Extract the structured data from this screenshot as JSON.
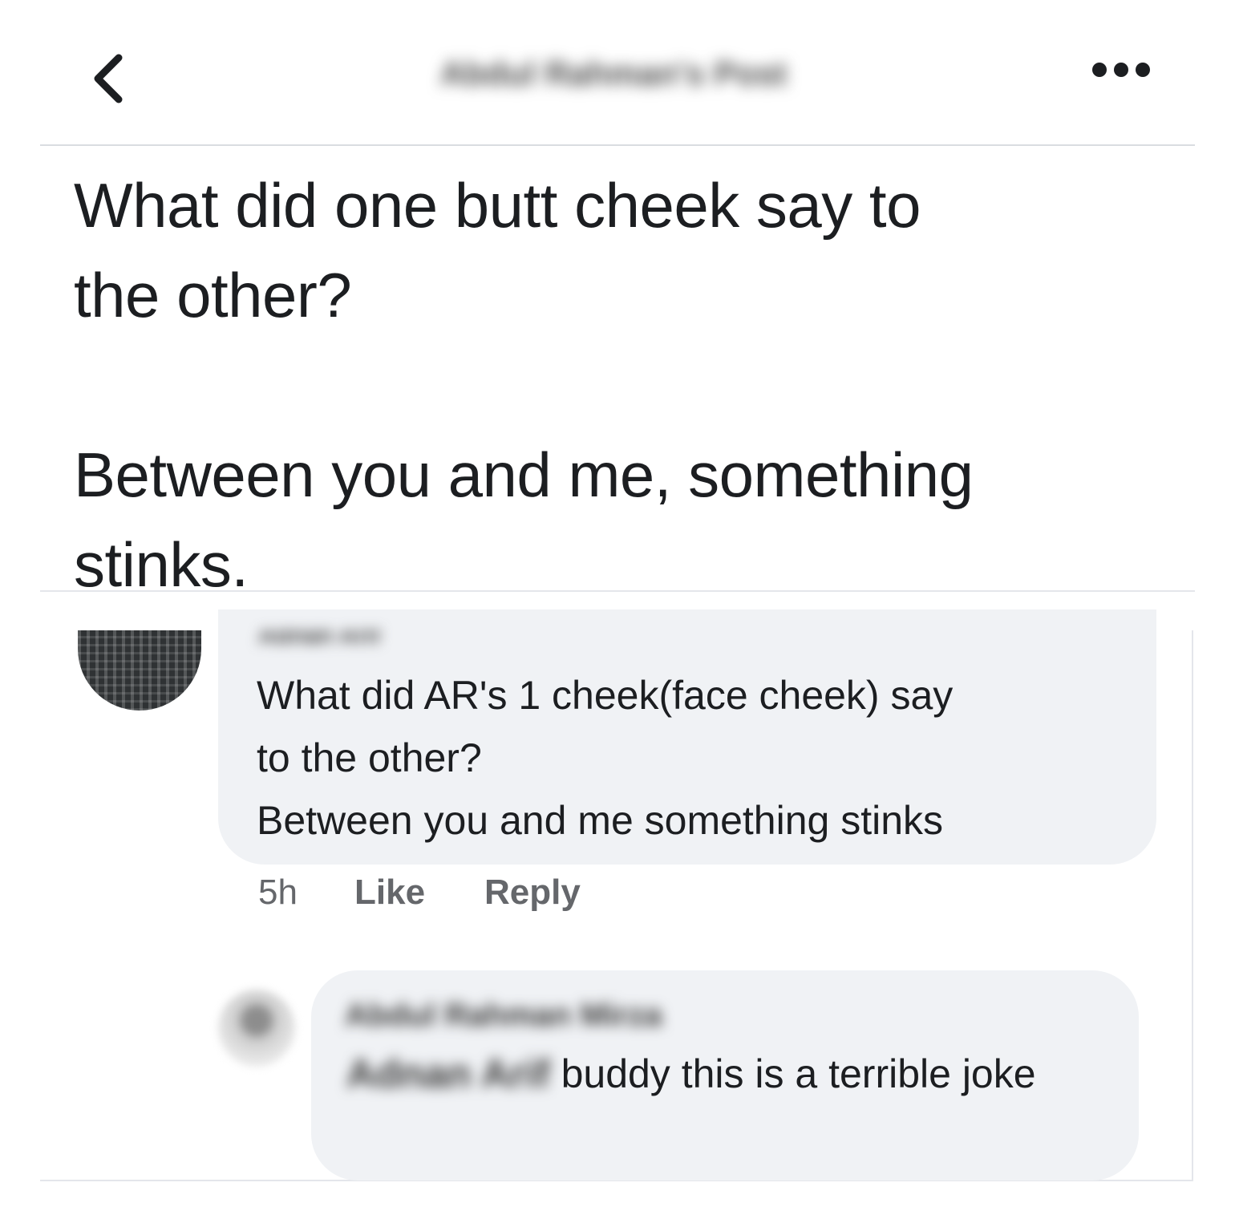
{
  "header": {
    "title": "Abdul Rahman's Post"
  },
  "post": {
    "text": "What did one butt cheek say to\nthe other?\n\nBetween you and me, something\nstinks."
  },
  "comment": {
    "author": "Adnan Arif",
    "text": "What did AR's 1 cheek(face cheek) say\nto the other?\nBetween you and me something stinks",
    "time": "5h",
    "like_label": "Like",
    "reply_label": "Reply"
  },
  "reply": {
    "author": "Abdul Rahman Mirza",
    "mention": "Adnan Arif",
    "text": " buddy this is a terrible joke"
  }
}
